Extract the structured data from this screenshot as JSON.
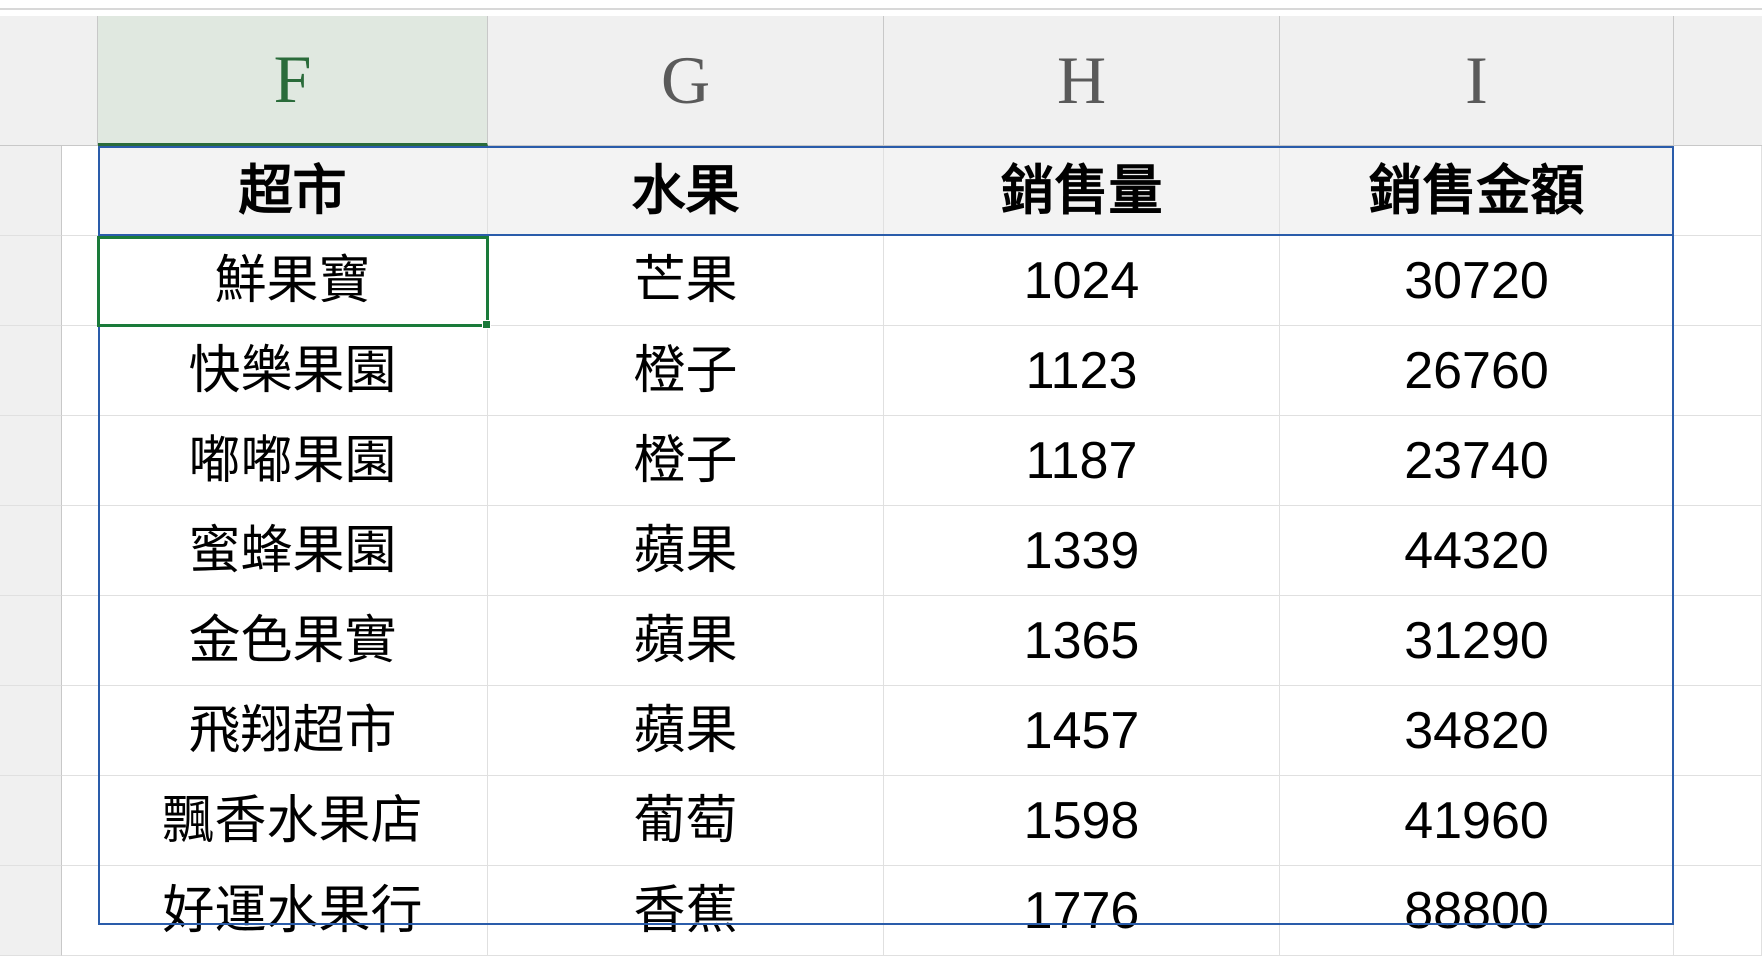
{
  "columns": [
    {
      "id": "F",
      "label": "F",
      "active": true
    },
    {
      "id": "G",
      "label": "G",
      "active": false
    },
    {
      "id": "H",
      "label": "H",
      "active": false
    },
    {
      "id": "I",
      "label": "I",
      "active": false
    }
  ],
  "headers": {
    "F": "超市",
    "G": "水果",
    "H": "銷售量",
    "I": "銷售金額"
  },
  "rows": [
    {
      "F": "鮮果寶",
      "G": "芒果",
      "H": "1024",
      "I": "30720"
    },
    {
      "F": "快樂果園",
      "G": "橙子",
      "H": "1123",
      "I": "26760"
    },
    {
      "F": "嘟嘟果園",
      "G": "橙子",
      "H": "1187",
      "I": "23740"
    },
    {
      "F": "蜜蜂果園",
      "G": "蘋果",
      "H": "1339",
      "I": "44320"
    },
    {
      "F": "金色果實",
      "G": "蘋果",
      "H": "1365",
      "I": "31290"
    },
    {
      "F": "飛翔超市",
      "G": "蘋果",
      "H": "1457",
      "I": "34820"
    },
    {
      "F": "飄香水果店",
      "G": "葡萄",
      "H": "1598",
      "I": "41960"
    },
    {
      "F": "好運水果行",
      "G": "香蕉",
      "H": "1776",
      "I": "88800"
    }
  ],
  "chart_data": {
    "type": "table",
    "title": "",
    "columns": [
      "超市",
      "水果",
      "銷售量",
      "銷售金額"
    ],
    "data": [
      [
        "鮮果寶",
        "芒果",
        1024,
        30720
      ],
      [
        "快樂果園",
        "橙子",
        1123,
        26760
      ],
      [
        "嘟嘟果園",
        "橙子",
        1187,
        23740
      ],
      [
        "蜜蜂果園",
        "蘋果",
        1339,
        44320
      ],
      [
        "金色果實",
        "蘋果",
        1365,
        31290
      ],
      [
        "飛翔超市",
        "蘋果",
        1457,
        34820
      ],
      [
        "飄香水果店",
        "葡萄",
        1598,
        41960
      ],
      [
        "好運水果行",
        "香蕉",
        1776,
        88800
      ]
    ]
  },
  "active_cell": "F2",
  "colors": {
    "table_border": "#2a5caa",
    "selection": "#1a7a3a",
    "header_bg": "#f3f3f3",
    "col_header_bg": "#f0f0f0"
  }
}
